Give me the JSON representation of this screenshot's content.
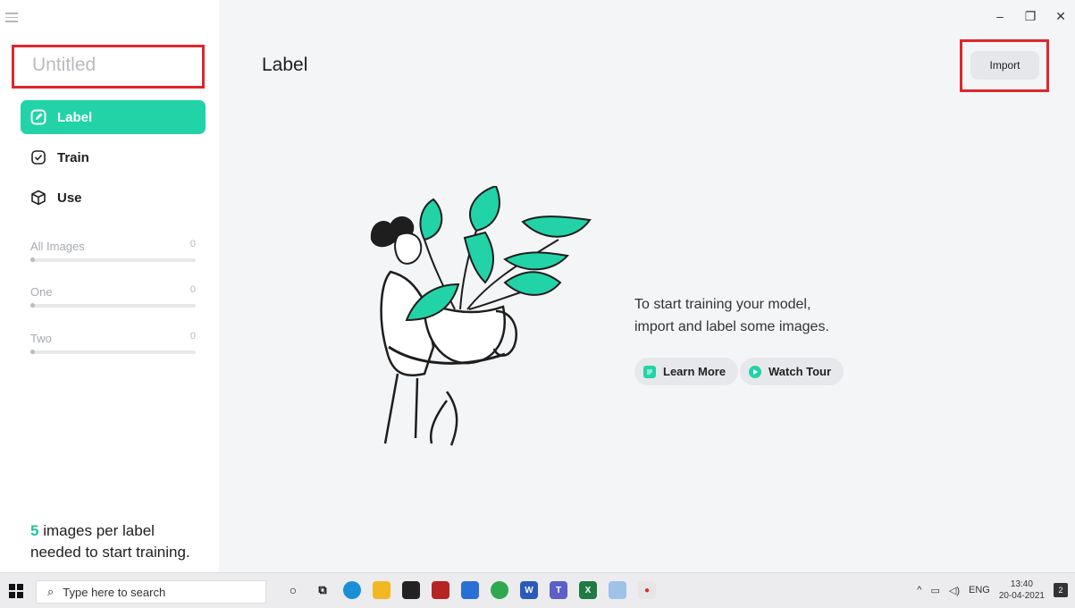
{
  "sidebar": {
    "project_title": "Untitled",
    "nav": [
      {
        "label": "Label",
        "icon": "edit-icon",
        "active": true
      },
      {
        "label": "Train",
        "icon": "check-square-icon",
        "active": false
      },
      {
        "label": "Use",
        "icon": "cube-icon",
        "active": false
      }
    ],
    "classes": [
      {
        "name": "All Images",
        "count": "0"
      },
      {
        "name": "One",
        "count": "0"
      },
      {
        "name": "Two",
        "count": "0"
      }
    ],
    "hint": {
      "number": "5",
      "text_part1": " images per label",
      "text_part2": "needed to start training."
    }
  },
  "main": {
    "title": "Label",
    "import_label": "Import",
    "empty_line1": "To start training your model,",
    "empty_line2": "import and label some images.",
    "learn_more": "Learn More",
    "watch_tour": "Watch Tour"
  },
  "window": {
    "minimize": "–",
    "restore": "❐",
    "close": "✕"
  },
  "taskbar": {
    "search_placeholder": "Type here to search",
    "apps": [
      "cortana-icon",
      "task-view-icon",
      "edge-icon",
      "file-explorer-icon",
      "store-icon",
      "game-icon",
      "mail-icon",
      "chrome-icon",
      "word-icon",
      "teams-icon",
      "excel-icon",
      "paint-icon",
      "lobe-icon"
    ],
    "lang": "ENG",
    "time": "13:40",
    "date": "20-04-2021",
    "notifications": "2"
  },
  "colors": {
    "accent": "#22d3a8",
    "highlight_frame": "#e0262b"
  }
}
